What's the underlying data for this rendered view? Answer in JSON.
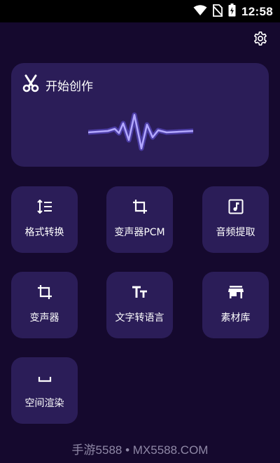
{
  "status_bar": {
    "time": "12:58",
    "icons": [
      "wifi-icon",
      "no-sim-icon",
      "battery-charging-icon"
    ]
  },
  "header": {
    "settings_icon": "gear-icon"
  },
  "hero": {
    "title": "开始创作",
    "icon": "scissors-icon"
  },
  "tools": [
    {
      "label": "格式转换",
      "icon": "format-list-icon"
    },
    {
      "label": "变声器PCM",
      "icon": "crop-icon"
    },
    {
      "label": "音频提取",
      "icon": "music-note-icon"
    },
    {
      "label": "变声器",
      "icon": "crop-icon"
    },
    {
      "label": "文字转语言",
      "icon": "text-size-icon"
    },
    {
      "label": "素材库",
      "icon": "store-icon"
    },
    {
      "label": "空间渲染",
      "icon": "space-bar-icon"
    }
  ],
  "watermark": "手游5588 • MX5588.COM",
  "colors": {
    "background": "#15092e",
    "card": "#2b1d58",
    "wave": "#7d6cff"
  }
}
